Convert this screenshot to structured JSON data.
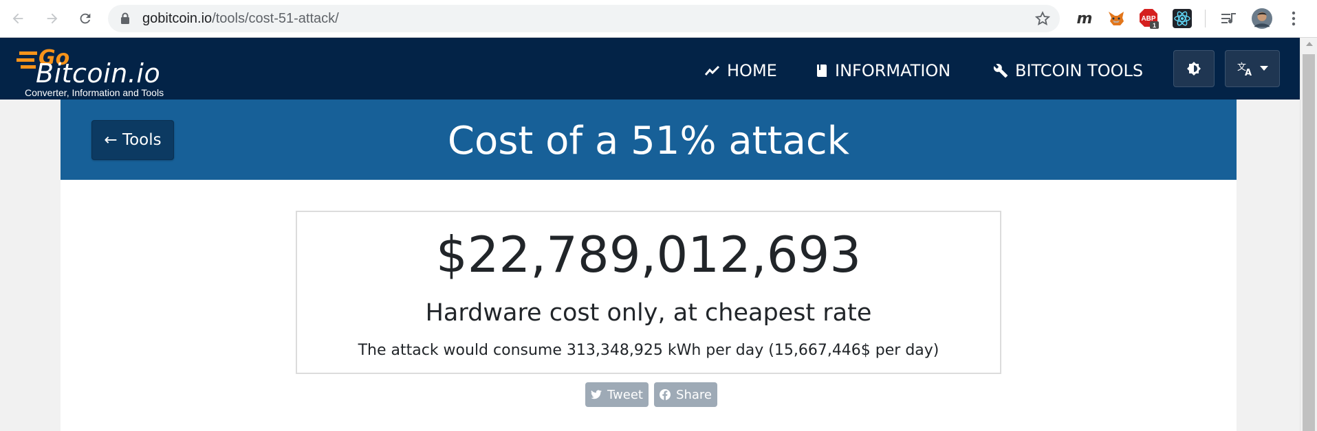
{
  "browser": {
    "url_host": "gobitcoin.io",
    "url_path": "/tools/cost-51-attack/",
    "abp_badge": "1"
  },
  "site": {
    "logo_go": "Go",
    "logo_main": "Bitcoin.io",
    "logo_tagline": "Converter, Information and Tools",
    "nav": [
      {
        "label": "HOME",
        "icon": "trend-icon"
      },
      {
        "label": "INFORMATION",
        "icon": "book-icon"
      },
      {
        "label": "BITCOIN TOOLS",
        "icon": "wrench-icon"
      }
    ]
  },
  "banner": {
    "back_label": "← Tools",
    "title": "Cost of a 51% attack"
  },
  "result": {
    "cost": "$22,789,012,693",
    "subtitle": "Hardware cost only, at cheapest rate",
    "detail": "The attack would consume 313,348,925 kWh per day (15,667,446$ per day)"
  },
  "share": {
    "tweet_label": "Tweet",
    "share_label": "Share"
  },
  "colors": {
    "header_bg": "#032347",
    "banner_bg": "#176098",
    "accent_orange": "#f7931a"
  }
}
